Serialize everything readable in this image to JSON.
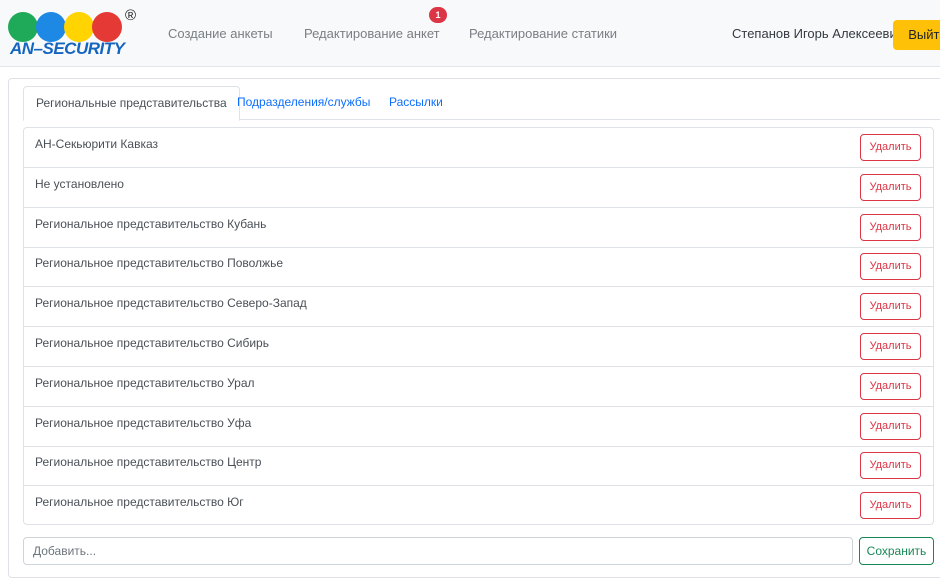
{
  "brand": {
    "logo_text": "AN–SECURITY",
    "registered_mark": "®",
    "dot_colors": [
      "#1faa59",
      "#1e88e5",
      "#ffd400",
      "#e53935"
    ]
  },
  "nav": {
    "links": [
      {
        "label": "Создание анкеты"
      },
      {
        "label": "Редактирование анкет",
        "badge": "1"
      },
      {
        "label": "Редактирование статики"
      }
    ],
    "user_name": "Степанов Игорь Алексеевич",
    "logout_label": "Выйти"
  },
  "tabs": [
    {
      "label": "Региональные представительства",
      "active": true
    },
    {
      "label": "Подразделения/службы",
      "active": false
    },
    {
      "label": "Рассылки",
      "active": false
    }
  ],
  "delete_label": "Удалить",
  "items": [
    "АН-Секьюрити Кавказ",
    "Не установлено",
    "Региональное представительство Кубань",
    "Региональное представительство Поволжье",
    "Региональное представительство Северо-Запад",
    "Региональное представительство Сибирь",
    "Региональное представительство Урал",
    "Региональное представительство Уфа",
    "Региональное представительство Центр",
    "Региональное представительство Юг"
  ],
  "add": {
    "placeholder": "Добавить...",
    "value": "",
    "save_label": "Сохранить"
  },
  "colors": {
    "danger": "#dc3545",
    "success": "#198754",
    "warning": "#ffc107",
    "link": "#0d6efd"
  }
}
